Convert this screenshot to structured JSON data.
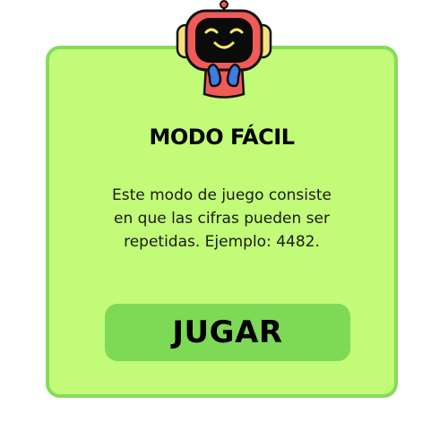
{
  "card": {
    "title": "MODO FÁCIL",
    "description_lines": [
      "Este modo de juego consiste",
      "en que las cifras pueden ser",
      "repetidas. Ejemplo: 4482."
    ],
    "play_button_label": "JUGAR"
  },
  "mascot": {
    "icon": "robot-mascot-icon"
  },
  "colors": {
    "card_background": "#c2fb78",
    "card_border": "#86db5a",
    "button_background": "#7ed957",
    "mascot_body": "#ef5b57",
    "mascot_ears": "#f7e07a",
    "mascot_hands": "#3f7be0"
  }
}
